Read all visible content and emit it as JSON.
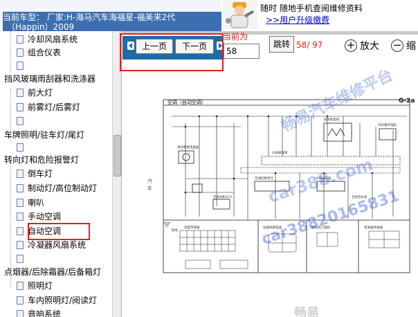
{
  "header": {
    "vehicle_title_line1": "当前车型：  厂家:H-海马汽车海福星-福美来2代",
    "vehicle_title_line2": "（Happin）2009",
    "promo_line1": "随时 随地手机查阅维修资料",
    "promo_link": ">>用户升级缴费"
  },
  "sidebar": {
    "rows": [
      {
        "kind": "leaf",
        "label": "冷却风扇系统"
      },
      {
        "kind": "leaf",
        "label": "组合仪表"
      },
      {
        "kind": "leaf",
        "label": ""
      },
      {
        "kind": "category",
        "label": "挡风玻璃雨刮器和洗涤器"
      },
      {
        "kind": "leaf",
        "label": "前大灯"
      },
      {
        "kind": "leaf",
        "label": "前雾灯/后雾灯"
      },
      {
        "kind": "leaf",
        "label": ""
      },
      {
        "kind": "category",
        "label": "车牌照明/驻车灯/尾灯"
      },
      {
        "kind": "leaf",
        "label": ""
      },
      {
        "kind": "category",
        "label": "转向灯和危险报警灯"
      },
      {
        "kind": "leaf",
        "label": "倒车灯"
      },
      {
        "kind": "leaf",
        "label": "制动灯/高位制动灯"
      },
      {
        "kind": "leaf",
        "label": "喇叭"
      },
      {
        "kind": "leaf",
        "label": "手动空调"
      },
      {
        "kind": "leaf",
        "label": "自动空调",
        "selected": true
      },
      {
        "kind": "leaf",
        "label": "冷凝器风扇系统"
      },
      {
        "kind": "leaf",
        "label": ""
      },
      {
        "kind": "category",
        "label": "点烟器/后除霜器/后备箱灯"
      },
      {
        "kind": "leaf",
        "label": "照明灯"
      },
      {
        "kind": "leaf",
        "label": "车内照明灯/阅读灯"
      },
      {
        "kind": "leaf",
        "label": "音响系统"
      }
    ]
  },
  "toolbar": {
    "prev_label": "上一页",
    "next_label": "下一页",
    "current_page_label": "当前为",
    "page_input_value": "58",
    "jump_label": "跳转",
    "page_count": "58/ 97",
    "zoom_in_label": "放大",
    "zoom_out_label": "缩"
  },
  "diagram": {
    "title": "空调（自动空调）",
    "code": "G-2a",
    "side_mark": "汽\n车",
    "labels": [
      "发动机舱电器盒",
      "空调控制单元",
      "仪表板线束",
      "鼓风机电机",
      "内外循环电机",
      "冷凝器风扇",
      "温度传感器",
      "压缩机继电器",
      "模式风门电机",
      "蒸发器传感器",
      "至发动机ECU",
      "至组合仪表",
      "接地"
    ]
  },
  "watermarks": [
    "畅易汽车维修平台",
    "car388.com",
    "car38820165831",
    "畅易"
  ],
  "colors": {
    "title_bar": "#3d6fb0",
    "nav_bar": "#1d6ca8",
    "highlight_red": "#e02020",
    "watermark_blue": "#3c64dc",
    "link_blue": "#0000cc"
  }
}
